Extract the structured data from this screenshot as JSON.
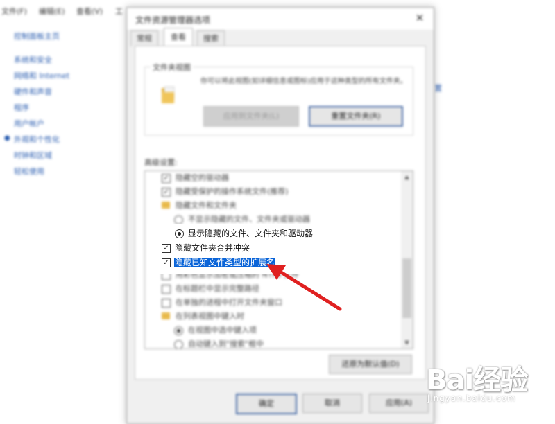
{
  "background": {
    "menu": [
      "文件(F)",
      "编辑(E)",
      "查看(V)",
      "工"
    ],
    "sidebar_home": "控制面板主页",
    "sidebar_items": [
      "系统和安全",
      "网络和 Internet",
      "硬件和声音",
      "程序",
      "用户帐户",
      "外观和个性化",
      "时钟和区域",
      "轻松使用"
    ],
    "right_link": "置"
  },
  "dialog": {
    "title": "文件资源管理器选项",
    "close_glyph": "✕",
    "tabs": [
      "常规",
      "查看",
      "搜索"
    ],
    "active_tab": "查看",
    "folder_views": {
      "group_title": "文件夹视图",
      "description": "你可以将此视图(如详细信息或图标)应用于这种类型的所有文件夹。",
      "apply_button": "应用到文件夹(L)",
      "reset_button": "重置文件夹(R)"
    },
    "advanced_label": "高级设置:",
    "advanced_items": [
      {
        "type": "checkbox",
        "checked": true,
        "label": "隐藏空的驱动器"
      },
      {
        "type": "checkbox",
        "checked": true,
        "label": "隐藏受保护的操作系统文件(推荐)"
      },
      {
        "type": "folder",
        "label": "隐藏文件和文件夹"
      },
      {
        "type": "radio",
        "selected": false,
        "label": "不显示隐藏的文件、文件夹或驱动器"
      },
      {
        "type": "radio",
        "selected": true,
        "label": "显示隐藏的文件、文件夹和驱动器"
      },
      {
        "type": "checkbox",
        "checked": true,
        "label": "隐藏文件夹合并冲突"
      },
      {
        "type": "checkbox",
        "checked": true,
        "label": "隐藏已知文件类型的扩展名",
        "highlighted": true
      },
      {
        "type": "checkbox",
        "checked": false,
        "label": "用彩色显示加密或压缩的 NTFS 文件"
      },
      {
        "type": "checkbox",
        "checked": false,
        "label": "在标题栏中显示完整路径"
      },
      {
        "type": "checkbox",
        "checked": false,
        "label": "在单独的进程中打开文件夹窗口"
      },
      {
        "type": "folder",
        "label": "在列表视图中键入时"
      },
      {
        "type": "radio",
        "selected": true,
        "label": "在视图中选中键入项"
      },
      {
        "type": "radio",
        "selected": false,
        "label": "自动键入到\"搜索\"框中"
      }
    ],
    "restore_defaults_button": "还原为默认值(D)",
    "ok_button": "确定",
    "cancel_button": "取消",
    "apply_button": "应用(A)"
  },
  "watermark": {
    "logo": "Bai经验",
    "url": "jingyan.baidu.com"
  },
  "colors": {
    "selection": "#0a64d8",
    "arrow": "#e02020",
    "folder": "#e8b94a"
  }
}
